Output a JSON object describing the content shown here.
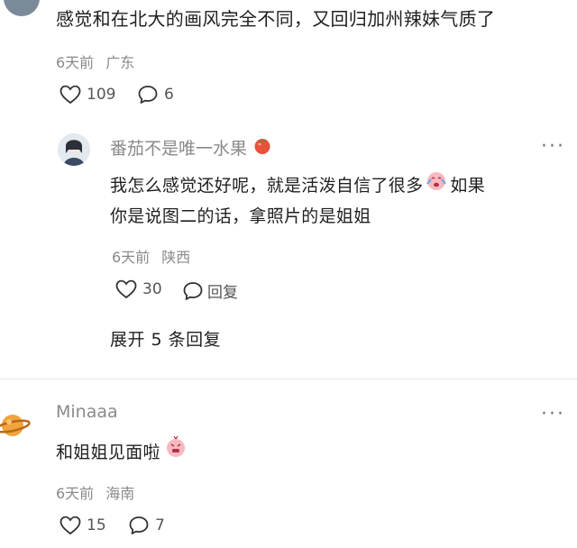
{
  "comment1": {
    "text": "感觉和在北大的画风完全不同，又回归加州辣妹气质了",
    "time": "6天前",
    "location": "广东",
    "likes": "109",
    "replies": "6"
  },
  "reply1": {
    "username": "番茄不是唯一水果",
    "text_line1": "我怎么感觉还好呢，就是活泼自信了很多",
    "text_line1b": "如果",
    "text_line2": "你是说图二的话，拿照片的是姐姐",
    "time": "6天前",
    "location": "陕西",
    "likes": "30",
    "reply_label": "回复"
  },
  "expand": {
    "label": "展开 5 条回复"
  },
  "comment2": {
    "username": "Minaaa",
    "text": "和姐姐见面啦",
    "time": "6天前",
    "location": "海南",
    "likes": "15",
    "replies": "7"
  },
  "icons": {
    "like": "heart-outline-icon",
    "comment": "speech-bubble-icon",
    "more": "more-dots-icon",
    "tomato": "tomato-emoji",
    "cry": "crying-face-emoji",
    "blush": "shy-face-emoji"
  },
  "colors": {
    "text": "#1f1f1f",
    "meta": "#8a8a8a",
    "tomato": "#e8513a",
    "emoji_pink": "#f4a7b0"
  }
}
